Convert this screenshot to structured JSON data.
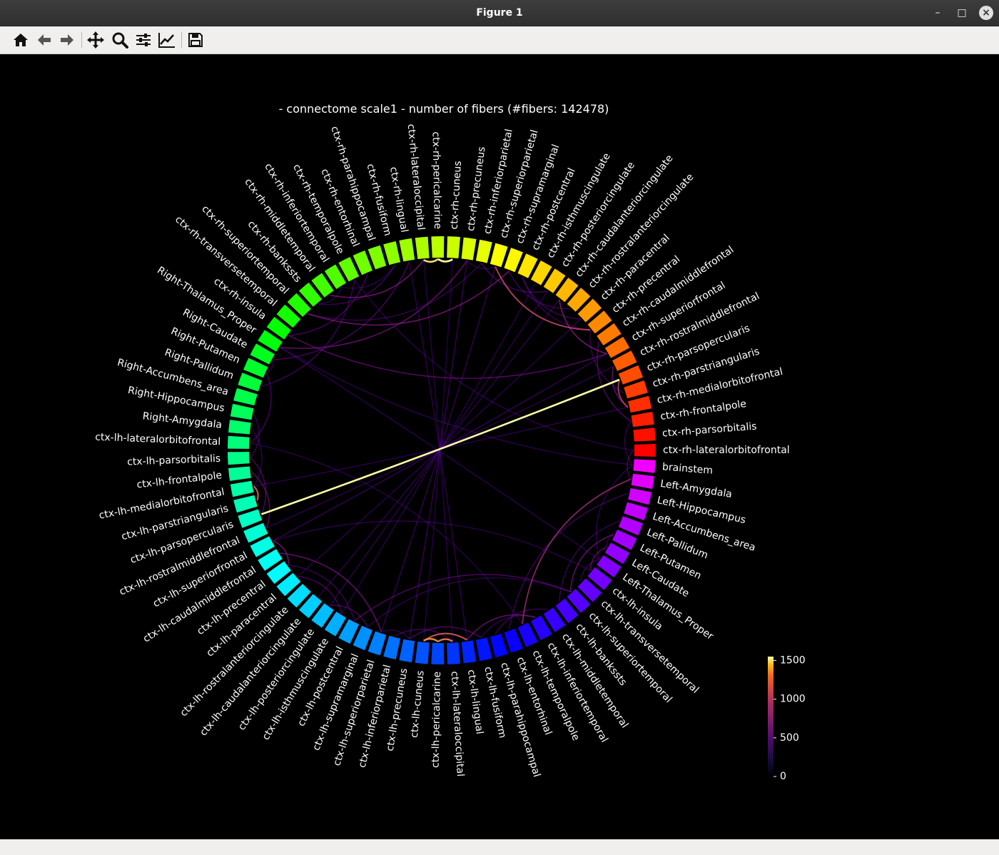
{
  "window": {
    "title": "Figure 1"
  },
  "toolbar": {
    "tools": [
      {
        "name": "home-icon"
      },
      {
        "name": "back-arrow-icon"
      },
      {
        "name": "forward-arrow-icon"
      },
      {
        "name": "pan-icon"
      },
      {
        "name": "zoom-icon"
      },
      {
        "name": "configure-subplots-icon"
      },
      {
        "name": "edit-axis-icon"
      },
      {
        "name": "save-icon"
      }
    ]
  },
  "colors": {
    "background": "#000000",
    "text": "#ffffff",
    "colormap": "plasma"
  },
  "chart_data": {
    "type": "chord",
    "title": "- connectome scale1 - number of fibers (#fibers: 142478)",
    "nodes": [
      "ctx-rh-lateralorbitofrontal",
      "ctx-rh-parsorbitalis",
      "ctx-rh-frontalpole",
      "ctx-rh-medialorbitofrontal",
      "ctx-rh-parstriangularis",
      "ctx-rh-parsopercularis",
      "ctx-rh-rostralmiddlefrontal",
      "ctx-rh-superiorfrontal",
      "ctx-rh-caudalmiddlefrontal",
      "ctx-rh-precentral",
      "ctx-rh-paracentral",
      "ctx-rh-rostralanteriorcingulate",
      "ctx-rh-caudalanteriorcingulate",
      "ctx-rh-posteriorcingulate",
      "ctx-rh-isthmuscingulate",
      "ctx-rh-postcentral",
      "ctx-rh-supramarginal",
      "ctx-rh-superiorparietal",
      "ctx-rh-inferiorparietal",
      "ctx-rh-precuneus",
      "ctx-rh-cuneus",
      "ctx-rh-pericalcarine",
      "ctx-rh-lateraloccipital",
      "ctx-rh-lingual",
      "ctx-rh-fusiform",
      "ctx-rh-parahippocampal",
      "ctx-rh-entorhinal",
      "ctx-rh-temporalpole",
      "ctx-rh-inferiortemporal",
      "ctx-rh-middletemporal",
      "ctx-rh-bankssts",
      "ctx-rh-superiortemporal",
      "ctx-rh-transversetemporal",
      "ctx-rh-insula",
      "Right-Thalamus_Proper",
      "Right-Caudate",
      "Right-Putamen",
      "Right-Pallidum",
      "Right-Accumbens_area",
      "Right-Hippocampus",
      "Right-Amygdala",
      "ctx-lh-lateralorbitofrontal",
      "ctx-lh-parsorbitalis",
      "ctx-lh-frontalpole",
      "ctx-lh-medialorbitofrontal",
      "ctx-lh-parstriangularis",
      "ctx-lh-parsopercularis",
      "ctx-lh-rostralmiddlefrontal",
      "ctx-lh-superiorfrontal",
      "ctx-lh-caudalmiddlefrontal",
      "ctx-lh-precentral",
      "ctx-lh-paracentral",
      "ctx-lh-rostralanteriorcingulate",
      "ctx-lh-caudalanteriorcingulate",
      "ctx-lh-posteriorcingulate",
      "ctx-lh-isthmuscingulate",
      "ctx-lh-postcentral",
      "ctx-lh-supramarginal",
      "ctx-lh-superiorparietal",
      "ctx-lh-inferiorparietal",
      "ctx-lh-precuneus",
      "ctx-lh-cuneus",
      "ctx-lh-pericalcarine",
      "ctx-lh-lateraloccipital",
      "ctx-lh-lingual",
      "ctx-lh-fusiform",
      "ctx-lh-parahippocampal",
      "ctx-lh-entorhinal",
      "ctx-lh-temporalpole",
      "ctx-lh-inferiortemporal",
      "ctx-lh-middletemporal",
      "ctx-lh-bankssts",
      "ctx-lh-superiortemporal",
      "ctx-lh-transversetemporal",
      "ctx-lh-insula",
      "Left-Thalamus_Proper",
      "Left-Caudate",
      "Left-Putamen",
      "Left-Pallidum",
      "Left-Accumbens_area",
      "Left-Hippocampus",
      "Left-Amygdala",
      "brainstem"
    ],
    "links": [
      {
        "source": "ctx-rh-pericalcarine",
        "target": "ctx-rh-lateraloccipital",
        "value": 1500
      },
      {
        "source": "ctx-rh-pericalcarine",
        "target": "ctx-rh-cuneus",
        "value": 1550
      },
      {
        "source": "ctx-lh-pericalcarine",
        "target": "ctx-lh-lateraloccipital",
        "value": 1300
      },
      {
        "source": "ctx-lh-pericalcarine",
        "target": "ctx-lh-cuneus",
        "value": 1350
      },
      {
        "source": "ctx-lh-lingual",
        "target": "ctx-lh-cuneus",
        "value": 1100
      },
      {
        "source": "ctx-rh-parsopercularis",
        "target": "ctx-lh-parsopercularis",
        "value": 1550
      },
      {
        "source": "ctx-lh-parstriangularis",
        "target": "ctx-lh-medialorbitofrontal",
        "value": 1150
      },
      {
        "source": "ctx-rh-parsopercularis",
        "target": "ctx-rh-medialorbitofrontal",
        "value": 950
      },
      {
        "source": "ctx-rh-precentral",
        "target": "ctx-rh-superiorparietal",
        "value": 1000
      },
      {
        "source": "Left-Amygdala",
        "target": "ctx-lh-temporalpole",
        "value": 800
      },
      {
        "source": "ctx-rh-superiorfrontal",
        "target": "ctx-rh-caudalanteriorcingulate",
        "value": 700
      },
      {
        "source": "ctx-rh-superiortemporal",
        "target": "ctx-rh-supramarginal",
        "value": 650
      },
      {
        "source": "ctx-lh-superiorfrontal",
        "target": "ctx-lh-precentral",
        "value": 650
      },
      {
        "source": "ctx-lh-caudalmiddlefrontal",
        "target": "ctx-lh-superiorparietal",
        "value": 600
      },
      {
        "source": "Right-Thalamus_Proper",
        "target": "ctx-rh-precuneus",
        "value": 600
      },
      {
        "source": "ctx-rh-middletemporal",
        "target": "ctx-rh-lateraloccipital",
        "value": 650
      },
      {
        "source": "ctx-lh-inferiortemporal",
        "target": "ctx-lh-lingual",
        "value": 600
      },
      {
        "source": "ctx-rh-insula",
        "target": "ctx-rh-superiorfrontal",
        "value": 550
      },
      {
        "source": "Left-Putamen",
        "target": "ctx-lh-superiortemporal",
        "value": 600
      },
      {
        "source": "Left-Caudate",
        "target": "ctx-lh-insula",
        "value": 550
      },
      {
        "source": "ctx-rh-rostralmiddlefrontal",
        "target": "ctx-rh-medialorbitofrontal",
        "value": 600
      },
      {
        "source": "ctx-rh-caudalmiddlefrontal",
        "target": "ctx-rh-frontalpole",
        "value": 500
      },
      {
        "source": "ctx-lh-rostralmiddlefrontal",
        "target": "ctx-lh-frontalpole",
        "value": 550
      },
      {
        "source": "ctx-lh-parsorbitalis",
        "target": "ctx-lh-parsopercularis",
        "value": 500
      },
      {
        "source": "Right-Caudate",
        "target": "ctx-rh-lingual",
        "value": 450
      },
      {
        "source": "Right-Putamen",
        "target": "ctx-lh-lateralorbitofrontal",
        "value": 450
      },
      {
        "source": "ctx-rh-lateralorbitofrontal",
        "target": "Left-Amygdala",
        "value": 450
      },
      {
        "source": "ctx-lh-postcentral",
        "target": "ctx-lh-superiortemporal",
        "value": 500
      },
      {
        "source": "ctx-lh-precuneus",
        "target": "ctx-lh-fusiform",
        "value": 500
      },
      {
        "source": "ctx-lh-isthmuscingulate",
        "target": "ctx-lh-paracentral",
        "value": 450
      },
      {
        "source": "ctx-rh-entorhinal",
        "target": "ctx-rh-insula",
        "value": 450
      },
      {
        "source": "ctx-rh-temporalpole",
        "target": "Right-Pallidum",
        "value": 400
      },
      {
        "source": "ctx-rh-fusiform",
        "target": "ctx-rh-bankssts",
        "value": 400
      },
      {
        "source": "ctx-rh-inferiorparietal",
        "target": "ctx-rh-posteriorcingulate",
        "value": 450
      },
      {
        "source": "ctx-rh-postcentral",
        "target": "ctx-rh-paracentral",
        "value": 400
      },
      {
        "source": "ctx-rh-supramarginal",
        "target": "ctx-rh-rostralanteriorcingulate",
        "value": 400
      },
      {
        "source": "ctx-lh-supramarginal",
        "target": "ctx-lh-posteriorcingulate",
        "value": 450
      },
      {
        "source": "ctx-lh-inferiorparietal",
        "target": "ctx-lh-lateraloccipital",
        "value": 400
      },
      {
        "source": "ctx-lh-middletemporal",
        "target": "ctx-lh-parahippocampal",
        "value": 400
      },
      {
        "source": "ctx-lh-entorhinal",
        "target": "Left-Hippocampus",
        "value": 400
      },
      {
        "source": "Left-Pallidum",
        "target": "ctx-lh-bankssts",
        "value": 380
      },
      {
        "source": "Left-Thalamus_Proper",
        "target": "ctx-lh-transversetemporal",
        "value": 380
      },
      {
        "source": "Right-Hippocampus",
        "target": "ctx-lh-parsorbitalis",
        "value": 380
      },
      {
        "source": "Right-Amygdala",
        "target": "ctx-lh-medialorbitofrontal",
        "value": 350
      },
      {
        "source": "ctx-rh-parstriangularis",
        "target": "ctx-rh-precentral",
        "value": 380
      },
      {
        "source": "ctx-rh-frontalpole",
        "target": "brainstem",
        "value": 350
      },
      {
        "source": "ctx-rh-precuneus",
        "target": "ctx-lh-precuneus",
        "value": 380
      },
      {
        "source": "ctx-rh-superiorparietal",
        "target": "ctx-lh-superiorparietal",
        "value": 350
      },
      {
        "source": "ctx-rh-lingual",
        "target": "ctx-lh-lingual",
        "value": 330
      },
      {
        "source": "ctx-rh-superiorfrontal",
        "target": "ctx-lh-superiorfrontal",
        "value": 350
      },
      {
        "source": "ctx-rh-rostralmiddlefrontal",
        "target": "ctx-lh-rostralmiddlefrontal",
        "value": 320
      },
      {
        "source": "ctx-rh-caudalanteriorcingulate",
        "target": "ctx-lh-caudalanteriorcingulate",
        "value": 330
      },
      {
        "source": "ctx-rh-posteriorcingulate",
        "target": "ctx-lh-posteriorcingulate",
        "value": 320
      },
      {
        "source": "ctx-rh-isthmuscingulate",
        "target": "ctx-lh-isthmuscingulate",
        "value": 300
      },
      {
        "source": "ctx-rh-paracentral",
        "target": "ctx-lh-paracentral",
        "value": 300
      },
      {
        "source": "ctx-rh-medialorbitofrontal",
        "target": "ctx-lh-medialorbitofrontal",
        "value": 300
      },
      {
        "source": "ctx-rh-lateraloccipital",
        "target": "ctx-lh-lateraloccipital",
        "value": 300
      },
      {
        "source": "Right-Thalamus_Proper",
        "target": "Left-Thalamus_Proper",
        "value": 300
      },
      {
        "source": "ctx-rh-cuneus",
        "target": "ctx-lh-cuneus",
        "value": 280
      },
      {
        "source": "ctx-rh-inferiorparietal",
        "target": "ctx-rh-superiortemporal",
        "value": 350
      },
      {
        "source": "ctx-lh-precentral",
        "target": "ctx-lh-postcentral",
        "value": 380
      },
      {
        "source": "ctx-rh-precentral",
        "target": "ctx-rh-postcentral",
        "value": 360
      },
      {
        "source": "Right-Caudate",
        "target": "Right-Putamen",
        "value": 350
      },
      {
        "source": "Left-Caudate",
        "target": "Left-Putamen",
        "value": 340
      },
      {
        "source": "ctx-lh-insula",
        "target": "ctx-lh-superiorfrontal",
        "value": 320
      },
      {
        "source": "ctx-rh-bankssts",
        "target": "ctx-rh-inferiortemporal",
        "value": 300
      },
      {
        "source": "brainstem",
        "target": "Left-Thalamus_Proper",
        "value": 330
      },
      {
        "source": "brainstem",
        "target": "Right-Thalamus_Proper",
        "value": 320
      },
      {
        "source": "ctx-lh-lateralorbitofrontal",
        "target": "ctx-lh-temporalpole",
        "value": 300
      },
      {
        "source": "ctx-rh-lateralorbitofrontal",
        "target": "ctx-rh-temporalpole",
        "value": 300
      },
      {
        "source": "ctx-lh-fusiform",
        "target": "ctx-lh-inferiortemporal",
        "value": 330
      },
      {
        "source": "ctx-rh-fusiform",
        "target": "ctx-rh-inferiortemporal",
        "value": 320
      },
      {
        "source": "ctx-lh-supramarginal",
        "target": "ctx-lh-superiortemporal",
        "value": 330
      },
      {
        "source": "ctx-rh-superiorparietal",
        "target": "ctx-rh-precuneus",
        "value": 340
      },
      {
        "source": "ctx-lh-superiorparietal",
        "target": "ctx-lh-precuneus",
        "value": 340
      }
    ],
    "colorbar": {
      "ticks": [
        0,
        500,
        1000,
        1500
      ],
      "range": [
        0,
        1550
      ],
      "colormap": "plasma"
    },
    "legend_placement": "bottom-right",
    "node_colormap": "hsv"
  }
}
